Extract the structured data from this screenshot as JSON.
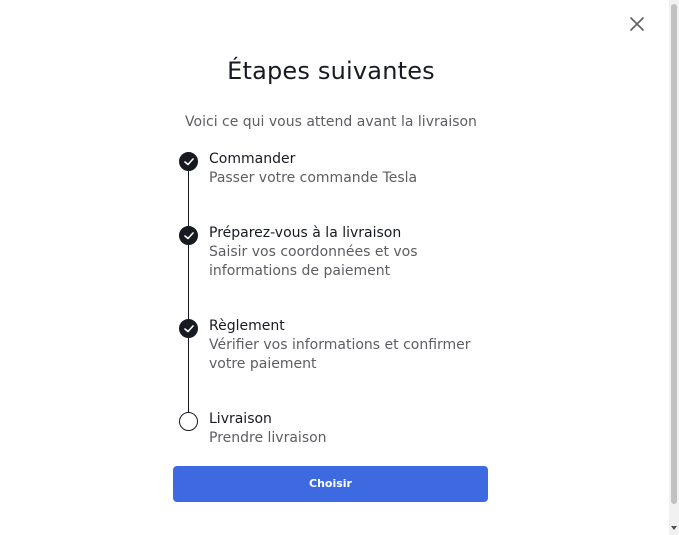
{
  "modal": {
    "title": "Étapes suivantes",
    "subtitle": "Voici ce qui vous attend avant la livraison",
    "close_icon": "close-icon"
  },
  "steps": [
    {
      "title": "Commander",
      "desc_lines": [
        "Passer votre commande Tesla"
      ],
      "status": "done"
    },
    {
      "title": "Préparez-vous à la livraison",
      "desc_lines": [
        "Saisir vos coordonnées et vos",
        "informations de paiement"
      ],
      "status": "done"
    },
    {
      "title": "Règlement",
      "desc_lines": [
        "Vérifier vos informations et confirmer",
        "votre paiement"
      ],
      "status": "done"
    },
    {
      "title": "Livraison",
      "desc_lines": [
        "Prendre livraison"
      ],
      "status": "pending"
    }
  ],
  "actions": {
    "choose_label": "Choisir"
  },
  "colors": {
    "primary_button": "#3e6ae1",
    "text_primary": "#171a20",
    "text_secondary": "#5c5e62"
  }
}
